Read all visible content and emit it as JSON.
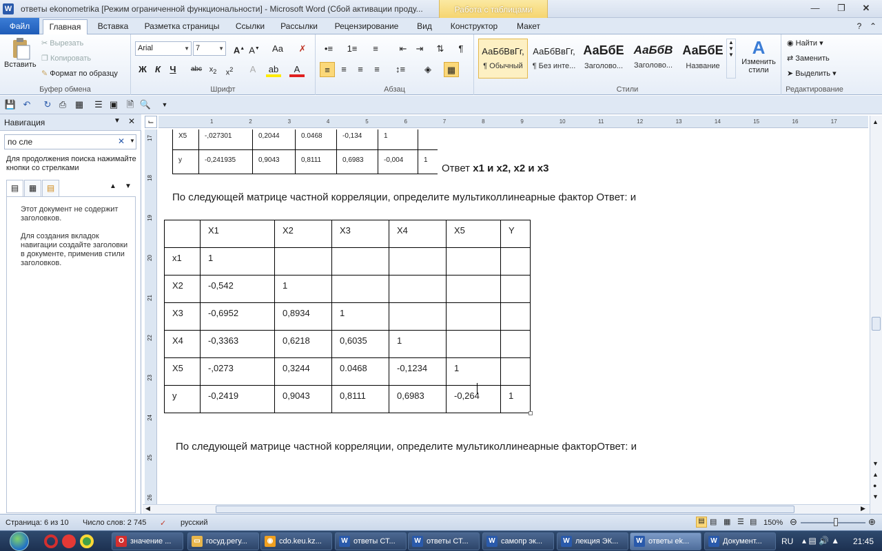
{
  "window": {
    "title": "ответы ekonometrika [Режим ограниченной функциональности]  -  Microsoft Word (Сбой активации проду...",
    "contextual_tab": "Работа с таблицами"
  },
  "tabs": [
    "Файл",
    "Главная",
    "Вставка",
    "Разметка страницы",
    "Ссылки",
    "Рассылки",
    "Рецензирование",
    "Вид",
    "Конструктор",
    "Макет"
  ],
  "ribbon": {
    "clipboard": {
      "paste": "Вставить",
      "cut": "Вырезать",
      "copy": "Копировать",
      "format_painter": "Формат по образцу",
      "label": "Буфер обмена"
    },
    "font": {
      "name": "Arial",
      "size": "7",
      "label": "Шрифт"
    },
    "paragraph": {
      "label": "Абзац"
    },
    "styles": {
      "label": "Стили",
      "items": [
        {
          "sample": "АаБбВвГг,",
          "name": "¶ Обычный"
        },
        {
          "sample": "АаБбВвГг,",
          "name": "¶ Без инте..."
        },
        {
          "sample": "АаБбЕ",
          "name": "Заголово..."
        },
        {
          "sample": "АаБбВ",
          "name": "Заголово..."
        },
        {
          "sample": "АаБбЕ",
          "name": "Название"
        }
      ],
      "change_styles": "Изменить стили"
    },
    "editing": {
      "find": "Найти",
      "replace": "Заменить",
      "select": "Выделить",
      "label": "Редактирование"
    }
  },
  "nav": {
    "title": "Навигация",
    "search_value": "по сле",
    "hint": "Для продолжения поиска нажимайте кнопки со стрелками",
    "empty_msg1": "Этот документ не содержит заголовков.",
    "empty_msg2": "Для создания вкладок навигации создайте заголовки в документе, применив стили заголовков."
  },
  "ruler": {
    "h_ticks": [
      "1",
      "2",
      "3",
      "4",
      "5",
      "6",
      "7",
      "8",
      "9",
      "10",
      "11",
      "12",
      "13",
      "14",
      "15",
      "16",
      "17"
    ],
    "v_ticks": [
      "17",
      "18",
      "19",
      "20",
      "21",
      "22",
      "23",
      "24",
      "25",
      "26"
    ]
  },
  "document": {
    "table1": [
      [
        "X5",
        "-,027301",
        "0,2044",
        "0.0468",
        "-0,134",
        "1",
        ""
      ],
      [
        "y",
        "-0,241935",
        "0,9043",
        "0,8111",
        "0,6983",
        "-0,004",
        "1"
      ]
    ],
    "answer_prefix": "Ответ ",
    "answer_bold": "x1 и x2, x2 и x3",
    "question1": "По следующей матрице частной корреляции, определите мультиколлинеарные фактор  Ответ:  и",
    "table2": {
      "header": [
        "",
        "X1",
        "X2",
        "X3",
        "X4",
        "X5",
        "Y"
      ],
      "rows": [
        [
          "x1",
          "1",
          "",
          "",
          "",
          "",
          ""
        ],
        [
          "X2",
          "-0,542",
          "1",
          "",
          "",
          "",
          ""
        ],
        [
          "X3",
          "-0,6952",
          "0,8934",
          "1",
          "",
          "",
          ""
        ],
        [
          "X4",
          "-0,3363",
          "0,6218",
          "0,6035",
          "1",
          "",
          ""
        ],
        [
          "X5",
          "-,0273",
          "0,3244",
          "0.0468",
          "-0,1234",
          "1",
          ""
        ],
        [
          "y",
          "-0,2419",
          "0,9043",
          "0,8111",
          "0,6983",
          "-0,264",
          "1"
        ]
      ]
    },
    "question2": "По следующей матрице частной корреляции, определите мультиколлинеарные факторОтвет:  и"
  },
  "status": {
    "page": "Страница: 6 из 10",
    "words": "Число слов: 2 745",
    "lang": "русский",
    "zoom": "150%"
  },
  "taskbar": {
    "items": [
      {
        "label": "значение ...",
        "icon": "O",
        "color": "#d32f2f"
      },
      {
        "label": "госуд.регу...",
        "icon": "▭",
        "color": "#e8b64c"
      },
      {
        "label": "cdo.keu.kz...",
        "icon": "◉",
        "color": "#f0a020"
      },
      {
        "label": "ответы СТ...",
        "icon": "W",
        "color": "#2a5aab"
      },
      {
        "label": "ответы СТ...",
        "icon": "W",
        "color": "#2a5aab"
      },
      {
        "label": "самопр эк...",
        "icon": "W",
        "color": "#2a5aab"
      },
      {
        "label": "лекция ЭК...",
        "icon": "W",
        "color": "#2a5aab"
      },
      {
        "label": "ответы ek...",
        "icon": "W",
        "color": "#2a5aab"
      },
      {
        "label": "Документ...",
        "icon": "W",
        "color": "#2a5aab"
      }
    ],
    "lang": "RU",
    "time": "21:45"
  }
}
